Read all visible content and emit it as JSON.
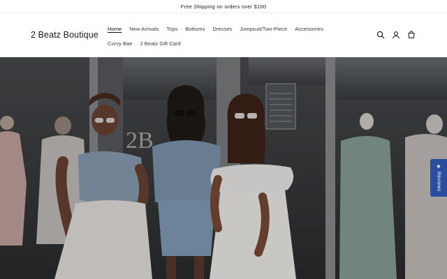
{
  "announcement": "Free Shipping on orders over $100",
  "brand": {
    "name": "2 Beatz Boutique"
  },
  "nav": {
    "items": [
      {
        "label": "Home",
        "active": true
      },
      {
        "label": "New Arrivals"
      },
      {
        "label": "Tops"
      },
      {
        "label": "Bottoms"
      },
      {
        "label": "Dresses"
      },
      {
        "label": "Jumpsuit/Two-Piece"
      },
      {
        "label": "Accessories"
      },
      {
        "label": "Curvy Bae"
      },
      {
        "label": "2 Beatz Gift Card"
      }
    ]
  },
  "header_icons": [
    "search-icon",
    "account-icon",
    "cart-icon"
  ],
  "hero": {
    "storefront_lettering": "2B"
  },
  "reviews_tab": {
    "label": "Reviews",
    "color": "#2a4d9e"
  }
}
